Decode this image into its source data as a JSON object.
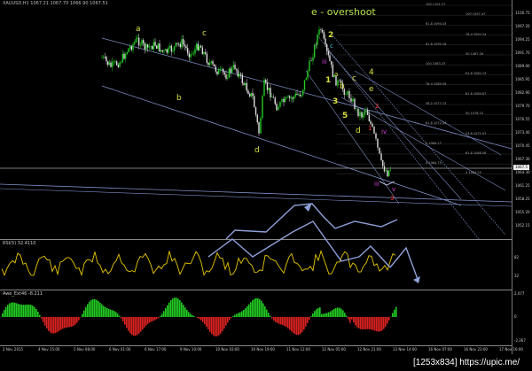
{
  "header": {
    "chart_title": "XAUUSD,H1  1067.21 1067.70 1066.90 1067.51",
    "wave_title": "e - overshoot"
  },
  "price_axis": {
    "ticks": [
      "1100.75",
      "1097.20",
      "1094.25",
      "1091.70",
      "1089.00",
      "1085.95",
      "1082.90",
      "1079.70",
      "1076.55",
      "1073.40",
      "1070.45",
      "1067.30",
      "1064.30",
      "1061.25",
      "1058.25",
      "1055.20",
      "1052.15"
    ],
    "current_price": "1067.5",
    "current_price_color": "#e8e8e8"
  },
  "fib_levels": [
    "100 1101.27",
    "100 1097.47",
    "61.8 1094.43",
    "76.4 1092.24",
    "61.8 1090.18",
    "50 1087.26",
    "100 1083.23",
    "61.8 1082.13",
    "76.4 1080.59",
    "61.8 1080.67",
    "38.2 1077.12",
    "50 1076.15",
    "61.8 1072.54",
    "23.6 1071.97",
    "0 1069.17",
    "61.8 1068.56",
    "0 1064.75",
    "0 1064.25"
  ],
  "wave_labels": {
    "a_top": "a",
    "c_top": "c",
    "b_left": "b",
    "b_mid": "b",
    "d_low": "d",
    "w2": "2",
    "w1": "1",
    "wa": "a",
    "wb": "b",
    "wc": "c",
    "w3": "3",
    "w4": "4",
    "we": "e",
    "w5": "5",
    "wd": "d",
    "r2": "2",
    "r1": "1",
    "r3": "3",
    "iii": "iii",
    "iv": "iv",
    "v": "v",
    "cyan_c": "c",
    "mag_iii": "iii"
  },
  "rsi_pane": {
    "label": "RSI(5) 32.4110",
    "ticks": [
      "82",
      "32"
    ]
  },
  "osc_pane": {
    "label": "Awe_Ext46  -8.211",
    "ticks": [
      "2.077",
      "0",
      "-2.267"
    ]
  },
  "time_axis": {
    "ticks": [
      "2 Nov 2015",
      "4 Nov 15:00",
      "5 Nov 08:00",
      "6 Nov 01:00",
      "6 Nov 17:00",
      "9 Nov 10:00",
      "10 Nov 03:00",
      "10 Nov 19:00",
      "11 Nov 12:00",
      "12 Nov 05:00",
      "12 Nov 21:00",
      "13 Nov 14:00",
      "16 Nov 07:00",
      "16 Nov 23:00",
      "17 Nov 16:00"
    ]
  },
  "watermark": "[1253x834] https://upic.me/",
  "colors": {
    "bull_candle": "#22cc22",
    "bear_candle": "#dddddd",
    "channel": "#7f8fc8",
    "rsi_line": "#e8c800",
    "osc_up": "#22cc22",
    "osc_down": "#dd2222",
    "wave_text": "#d8e040",
    "red_label": "#ff3030",
    "magenta_label": "#d040d0",
    "cyan_label": "#40c0e0"
  },
  "icons": {
    "timeframe_marker": "triangle-icon"
  }
}
